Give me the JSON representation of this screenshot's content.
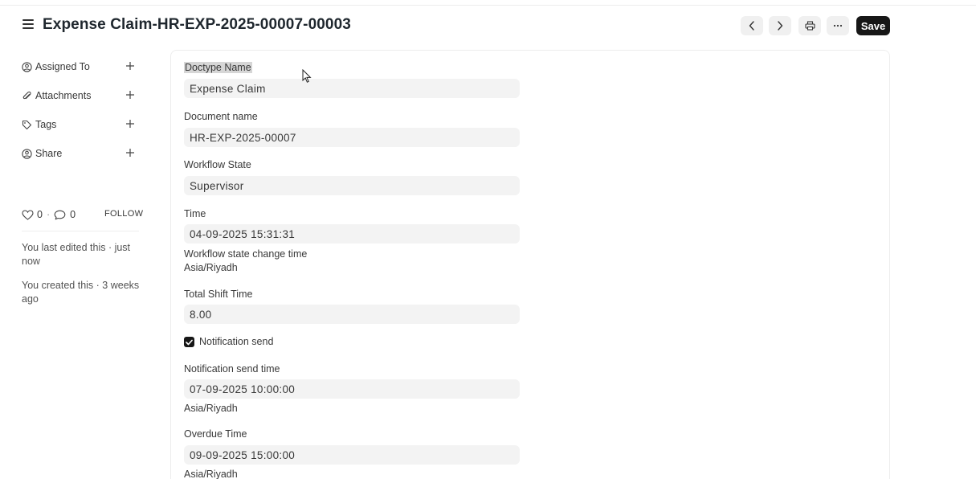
{
  "header": {
    "title": "Expense Claim-HR-EXP-2025-00007-00003",
    "save_label": "Save"
  },
  "sidebar": {
    "items": [
      {
        "label": "Assigned To",
        "icon": "assign-user-icon"
      },
      {
        "label": "Attachments",
        "icon": "paperclip-icon"
      },
      {
        "label": "Tags",
        "icon": "tag-icon"
      },
      {
        "label": "Share",
        "icon": "share-user-icon"
      }
    ],
    "likes": "0",
    "comments": "0",
    "follow_label": "FOLLOW",
    "activity": [
      "You last edited this · just now",
      "You created this · 3 weeks ago"
    ]
  },
  "form": {
    "doctype_name_label": "Doctype Name",
    "doctype_name_value": "Expense Claim",
    "document_name_label": "Document name",
    "document_name_value": "HR-EXP-2025-00007",
    "workflow_state_label": "Workflow State",
    "workflow_state_value": "Supervisor",
    "time_label": "Time",
    "time_value": "04-09-2025 15:31:31",
    "time_help": "Workflow state change time",
    "time_tz": "Asia/Riyadh",
    "total_shift_label": "Total Shift Time",
    "total_shift_value": "8.00",
    "notification_send_label": "Notification send",
    "notification_send_checked": true,
    "notification_time_label": "Notification send time",
    "notification_time_value": "07-09-2025 10:00:00",
    "notification_time_tz": "Asia/Riyadh",
    "overdue_label": "Overdue Time",
    "overdue_value": "09-09-2025 15:00:00",
    "overdue_tz": "Asia/Riyadh"
  },
  "colors": {
    "accent": "#171717",
    "input_bg": "#f3f3f3",
    "border": "#ededed"
  }
}
